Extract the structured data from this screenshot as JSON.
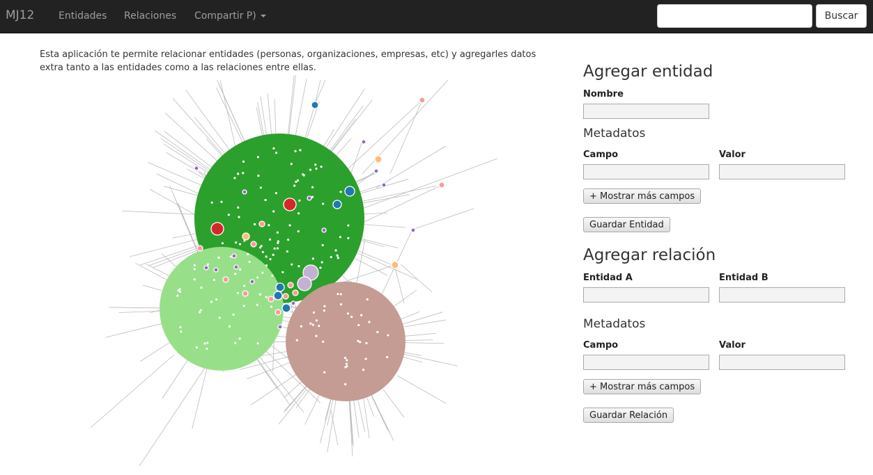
{
  "navbar": {
    "brand": "MJ12",
    "links": [
      "Entidades",
      "Relaciones"
    ],
    "share_dropdown": "Compartir P)",
    "search_placeholder": "",
    "search_button": "Buscar"
  },
  "intro": "Esta aplicación te permite relacionar entidades (personas, organizaciones, empresas, etc) y agregarles datos extra tanto a las entidades como a las relaciones entre ellas.",
  "add_entity": {
    "title": "Agregar entidad",
    "name_label": "Nombre",
    "metadata_title": "Metadatos",
    "field_label": "Campo",
    "value_label": "Valor",
    "more_fields_button": "+ Mostrar más campos",
    "save_button": "Guardar Entidad"
  },
  "add_relation": {
    "title": "Agregar relación",
    "entity_a_label": "Entidad A",
    "entity_b_label": "Entidad B",
    "metadata_title": "Metadatos",
    "field_label": "Campo",
    "value_label": "Valor",
    "more_fields_button": "+ Mostrar más campos",
    "save_button": "Guardar Relación"
  },
  "graph": {
    "colors": {
      "cluster_dark_green": "#2ca02c",
      "cluster_light_green": "#98df8a",
      "cluster_brown": "#c49c94",
      "blue": "#1f77b4",
      "red": "#d62728",
      "orange": "#ffbb78",
      "pink": "#ff9896",
      "purple": "#9467bd",
      "lavender": "#c5b0d5",
      "edge": "#bbbbbb"
    }
  }
}
